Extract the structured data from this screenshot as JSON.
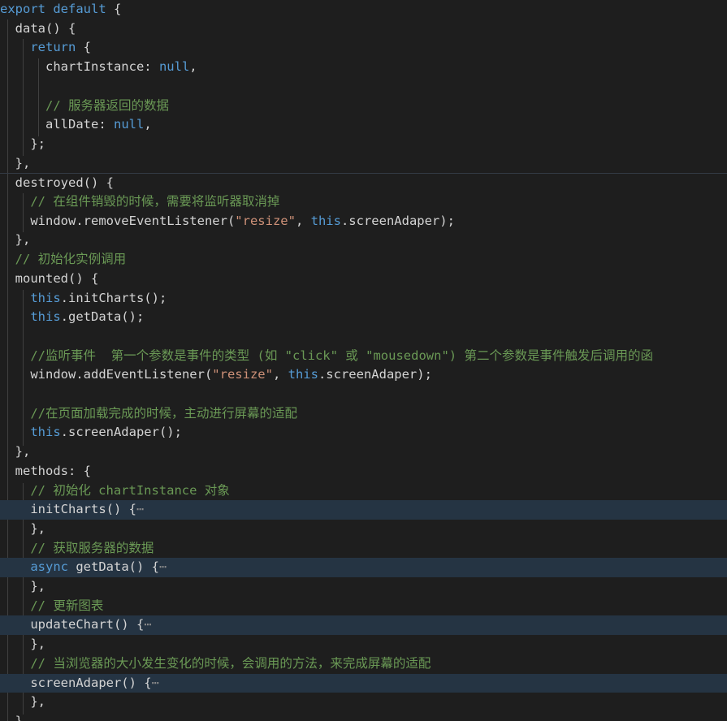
{
  "editor": {
    "language": "javascript",
    "lines": [
      {
        "tokens": [
          {
            "t": "export",
            "c": "keyword"
          },
          {
            "t": " ",
            "c": "default"
          },
          {
            "t": "default",
            "c": "keyword"
          },
          {
            "t": " {",
            "c": "default"
          }
        ]
      },
      {
        "tokens": [
          {
            "t": "  data() {",
            "c": "default"
          }
        ]
      },
      {
        "tokens": [
          {
            "t": "    ",
            "c": "default"
          },
          {
            "t": "return",
            "c": "keyword"
          },
          {
            "t": " {",
            "c": "default"
          }
        ]
      },
      {
        "tokens": [
          {
            "t": "      chartInstance: ",
            "c": "default"
          },
          {
            "t": "null",
            "c": "keyword"
          },
          {
            "t": ",",
            "c": "default"
          }
        ]
      },
      {
        "tokens": [
          {
            "t": "",
            "c": "default"
          }
        ]
      },
      {
        "tokens": [
          {
            "t": "      ",
            "c": "default"
          },
          {
            "t": "// 服务器返回的数据",
            "c": "comment"
          }
        ]
      },
      {
        "tokens": [
          {
            "t": "      allDate: ",
            "c": "default"
          },
          {
            "t": "null",
            "c": "keyword"
          },
          {
            "t": ",",
            "c": "default"
          }
        ]
      },
      {
        "tokens": [
          {
            "t": "    };",
            "c": "default"
          }
        ]
      },
      {
        "tokens": [
          {
            "t": "  },",
            "c": "default"
          }
        ]
      },
      {
        "tokens": [
          {
            "t": "  destroyed() {",
            "c": "default"
          }
        ],
        "boundary": true
      },
      {
        "tokens": [
          {
            "t": "    ",
            "c": "default"
          },
          {
            "t": "// 在组件销毁的时候，需要将监听器取消掉",
            "c": "comment"
          }
        ]
      },
      {
        "tokens": [
          {
            "t": "    window.removeEventListener(",
            "c": "default"
          },
          {
            "t": "\"resize\"",
            "c": "string"
          },
          {
            "t": ", ",
            "c": "default"
          },
          {
            "t": "this",
            "c": "keyword"
          },
          {
            "t": ".screenAdaper);",
            "c": "default"
          }
        ]
      },
      {
        "tokens": [
          {
            "t": "  },",
            "c": "default"
          }
        ]
      },
      {
        "tokens": [
          {
            "t": "  ",
            "c": "default"
          },
          {
            "t": "// 初始化实例调用",
            "c": "comment"
          }
        ]
      },
      {
        "tokens": [
          {
            "t": "  mounted() {",
            "c": "default"
          }
        ]
      },
      {
        "tokens": [
          {
            "t": "    ",
            "c": "default"
          },
          {
            "t": "this",
            "c": "keyword"
          },
          {
            "t": ".initCharts();",
            "c": "default"
          }
        ]
      },
      {
        "tokens": [
          {
            "t": "    ",
            "c": "default"
          },
          {
            "t": "this",
            "c": "keyword"
          },
          {
            "t": ".getData();",
            "c": "default"
          }
        ]
      },
      {
        "tokens": [
          {
            "t": "",
            "c": "default"
          }
        ]
      },
      {
        "tokens": [
          {
            "t": "    ",
            "c": "default"
          },
          {
            "t": "//监听事件  第一个参数是事件的类型 (如 \"click\" 或 \"mousedown\") 第二个参数是事件触发后调用的函",
            "c": "comment"
          }
        ]
      },
      {
        "tokens": [
          {
            "t": "    window.addEventListener(",
            "c": "default"
          },
          {
            "t": "\"resize\"",
            "c": "string"
          },
          {
            "t": ", ",
            "c": "default"
          },
          {
            "t": "this",
            "c": "keyword"
          },
          {
            "t": ".screenAdaper);",
            "c": "default"
          }
        ]
      },
      {
        "tokens": [
          {
            "t": "",
            "c": "default"
          }
        ]
      },
      {
        "tokens": [
          {
            "t": "    ",
            "c": "default"
          },
          {
            "t": "//在页面加载完成的时候，主动进行屏幕的适配",
            "c": "comment"
          }
        ]
      },
      {
        "tokens": [
          {
            "t": "    ",
            "c": "default"
          },
          {
            "t": "this",
            "c": "keyword"
          },
          {
            "t": ".screenAdaper();",
            "c": "default"
          }
        ]
      },
      {
        "tokens": [
          {
            "t": "  },",
            "c": "default"
          }
        ]
      },
      {
        "tokens": [
          {
            "t": "  methods: {",
            "c": "default"
          }
        ]
      },
      {
        "tokens": [
          {
            "t": "    ",
            "c": "default"
          },
          {
            "t": "// 初始化 chartInstance 对象",
            "c": "comment"
          }
        ]
      },
      {
        "tokens": [
          {
            "t": "    initCharts() {",
            "c": "default"
          },
          {
            "t": "⋯",
            "c": "ellipsis"
          }
        ],
        "folded": true
      },
      {
        "tokens": [
          {
            "t": "    },",
            "c": "default"
          }
        ]
      },
      {
        "tokens": [
          {
            "t": "    ",
            "c": "default"
          },
          {
            "t": "// 获取服务器的数据",
            "c": "comment"
          }
        ]
      },
      {
        "tokens": [
          {
            "t": "    ",
            "c": "default"
          },
          {
            "t": "async",
            "c": "keyword"
          },
          {
            "t": " getData() {",
            "c": "default"
          },
          {
            "t": "⋯",
            "c": "ellipsis"
          }
        ],
        "folded": true
      },
      {
        "tokens": [
          {
            "t": "    },",
            "c": "default"
          }
        ]
      },
      {
        "tokens": [
          {
            "t": "    ",
            "c": "default"
          },
          {
            "t": "// 更新图表",
            "c": "comment"
          }
        ]
      },
      {
        "tokens": [
          {
            "t": "    updateChart() {",
            "c": "default"
          },
          {
            "t": "⋯",
            "c": "ellipsis"
          }
        ],
        "folded": true
      },
      {
        "tokens": [
          {
            "t": "    },",
            "c": "default"
          }
        ]
      },
      {
        "tokens": [
          {
            "t": "    ",
            "c": "default"
          },
          {
            "t": "// 当浏览器的大小发生变化的时候，会调用的方法，来完成屏幕的适配",
            "c": "comment"
          }
        ]
      },
      {
        "tokens": [
          {
            "t": "    screenAdaper() {",
            "c": "default"
          },
          {
            "t": "⋯",
            "c": "ellipsis"
          }
        ],
        "folded": true
      },
      {
        "tokens": [
          {
            "t": "    },",
            "c": "default"
          }
        ]
      },
      {
        "tokens": [
          {
            "t": "  },",
            "c": "default"
          }
        ]
      }
    ]
  }
}
